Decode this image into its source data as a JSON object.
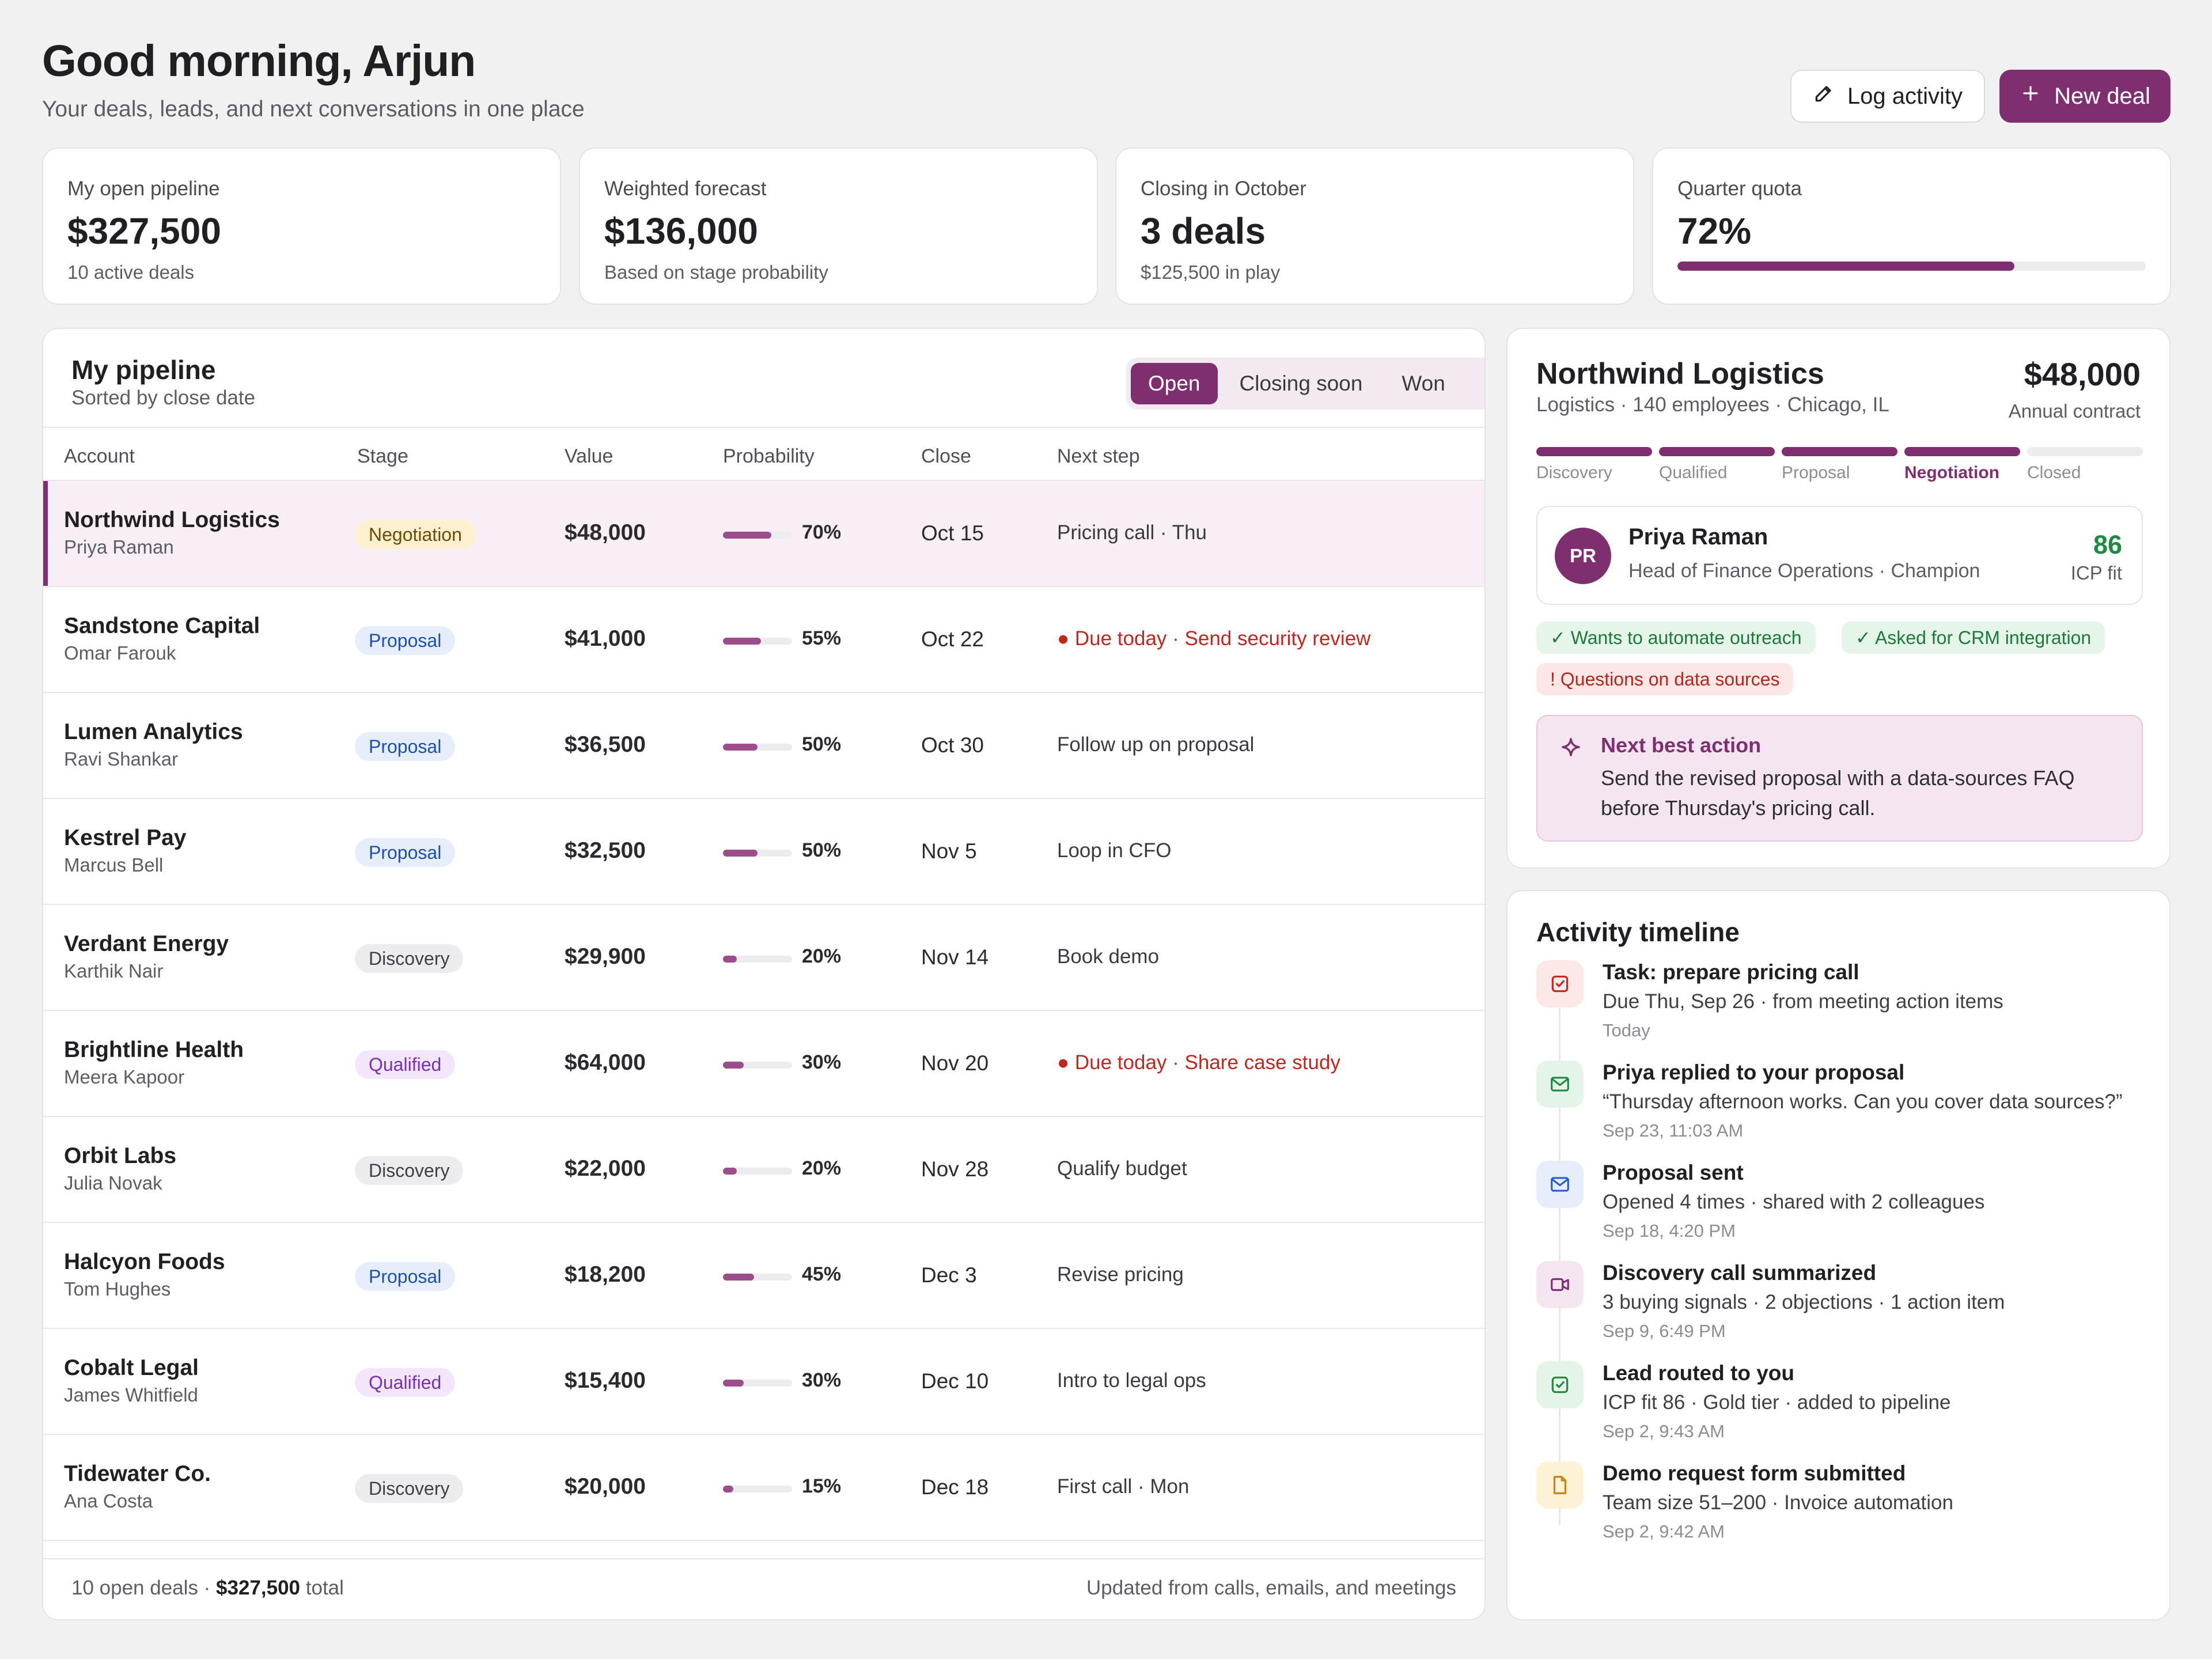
{
  "header": {
    "greeting": "Good morning, Arjun",
    "subtitle": "Your deals, leads, and next conversations in one place",
    "log_activity_label": "Log activity",
    "new_deal_label": "New deal"
  },
  "kpis": [
    {
      "label": "My open pipeline",
      "value": "$327,500",
      "sub": "10 active deals"
    },
    {
      "label": "Weighted forecast",
      "value": "$136,000",
      "sub": "Based on stage probability"
    },
    {
      "label": "Closing in October",
      "value": "3 deals",
      "sub": "$125,500 in play"
    },
    {
      "label": "Quarter quota",
      "value": "72%",
      "progress": 0.72
    }
  ],
  "pipeline": {
    "title": "My pipeline",
    "subtitle": "Sorted by close date",
    "filters": [
      "Open",
      "Closing soon",
      "Won"
    ],
    "active_filter": "Open",
    "columns": [
      "Account",
      "Stage",
      "Value",
      "Probability",
      "Close",
      "Next step"
    ],
    "rows": [
      {
        "account": "Northwind Logistics",
        "contact": "Priya Raman",
        "stage": "Negotiation",
        "value": "$48,000",
        "probability": "70%",
        "close": "Oct 15",
        "next": "Pricing call · Thu",
        "urgent": false,
        "selected": true
      },
      {
        "account": "Sandstone Capital",
        "contact": "Omar Farouk",
        "stage": "Proposal",
        "value": "$41,000",
        "probability": "55%",
        "close": "Oct 22",
        "next": "● Due today · Send security review",
        "urgent": true,
        "selected": false
      },
      {
        "account": "Lumen Analytics",
        "contact": "Ravi Shankar",
        "stage": "Proposal",
        "value": "$36,500",
        "probability": "50%",
        "close": "Oct 30",
        "next": "Follow up on proposal",
        "urgent": false,
        "selected": false
      },
      {
        "account": "Kestrel Pay",
        "contact": "Marcus Bell",
        "stage": "Proposal",
        "value": "$32,500",
        "probability": "50%",
        "close": "Nov 5",
        "next": "Loop in CFO",
        "urgent": false,
        "selected": false
      },
      {
        "account": "Verdant Energy",
        "contact": "Karthik Nair",
        "stage": "Discovery",
        "value": "$29,900",
        "probability": "20%",
        "close": "Nov 14",
        "next": "Book demo",
        "urgent": false,
        "selected": false
      },
      {
        "account": "Brightline Health",
        "contact": "Meera Kapoor",
        "stage": "Qualified",
        "value": "$64,000",
        "probability": "30%",
        "close": "Nov 20",
        "next": "● Due today · Share case study",
        "urgent": true,
        "selected": false
      },
      {
        "account": "Orbit Labs",
        "contact": "Julia Novak",
        "stage": "Discovery",
        "value": "$22,000",
        "probability": "20%",
        "close": "Nov 28",
        "next": "Qualify budget",
        "urgent": false,
        "selected": false
      },
      {
        "account": "Halcyon Foods",
        "contact": "Tom Hughes",
        "stage": "Proposal",
        "value": "$18,200",
        "probability": "45%",
        "close": "Dec 3",
        "next": "Revise pricing",
        "urgent": false,
        "selected": false
      },
      {
        "account": "Cobalt Legal",
        "contact": "James Whitfield",
        "stage": "Qualified",
        "value": "$15,400",
        "probability": "30%",
        "close": "Dec 10",
        "next": "Intro to legal ops",
        "urgent": false,
        "selected": false
      },
      {
        "account": "Tidewater Co.",
        "contact": "Ana Costa",
        "stage": "Discovery",
        "value": "$20,000",
        "probability": "15%",
        "close": "Dec 18",
        "next": "First call · Mon",
        "urgent": false,
        "selected": false
      }
    ],
    "footer_count": "10 open deals ·",
    "footer_total": "$327,500",
    "footer_total_suffix": "total",
    "footer_right": "Updated from calls, emails, and meetings"
  },
  "account": {
    "name": "Northwind Logistics",
    "meta": "Logistics · 140 employees · Chicago, IL",
    "amount": "$48,000",
    "amount_label": "Annual contract",
    "stages": [
      "Discovery",
      "Qualified",
      "Proposal",
      "Negotiation",
      "Closed"
    ],
    "current_stage_index": 3,
    "contact": {
      "initials": "PR",
      "name": "Priya Raman",
      "role": "Head of Finance Operations · Champion",
      "icp_score": "86",
      "icp_label": "ICP fit"
    },
    "signals": [
      {
        "text": "✓ Wants to automate outreach",
        "kind": "positive"
      },
      {
        "text": "✓ Asked for CRM integration",
        "kind": "positive"
      },
      {
        "text": "! Questions on data sources",
        "kind": "negative"
      }
    ],
    "next_best_action": {
      "title": "Next best action",
      "text": "Send the revised proposal with a data-sources FAQ before Thursday's pricing call."
    }
  },
  "timeline": {
    "title": "Activity timeline",
    "items": [
      {
        "icon": "task-check-icon",
        "tone": "red",
        "title": "Task: prepare pricing call",
        "desc": "Due Thu, Sep 26 · from meeting action items",
        "time": "Today"
      },
      {
        "icon": "mail-icon",
        "tone": "green",
        "title": "Priya replied to your proposal",
        "desc": "“Thursday afternoon works. Can you cover data sources?”",
        "time": "Sep 23, 11:03 AM"
      },
      {
        "icon": "mail-icon",
        "tone": "blue",
        "title": "Proposal sent",
        "desc": "Opened 4 times · shared with 2 colleagues",
        "time": "Sep 18, 4:20 PM"
      },
      {
        "icon": "video-icon",
        "tone": "purple",
        "title": "Discovery call summarized",
        "desc": "3 buying signals · 2 objections · 1 action item",
        "time": "Sep 9, 6:49 PM"
      },
      {
        "icon": "check-square-icon",
        "tone": "green",
        "title": "Lead routed to you",
        "desc": "ICP fit 86 · Gold tier · added to pipeline",
        "time": "Sep 2, 9:43 AM"
      },
      {
        "icon": "document-icon",
        "tone": "amber",
        "title": "Demo request form submitted",
        "desc": "Team size 51–200 · Invoice automation",
        "time": "Sep 2, 9:42 AM"
      }
    ]
  },
  "colors": {
    "accent": "#7f2f6f",
    "danger": "#c0271e",
    "success": "#1f8a3f"
  }
}
